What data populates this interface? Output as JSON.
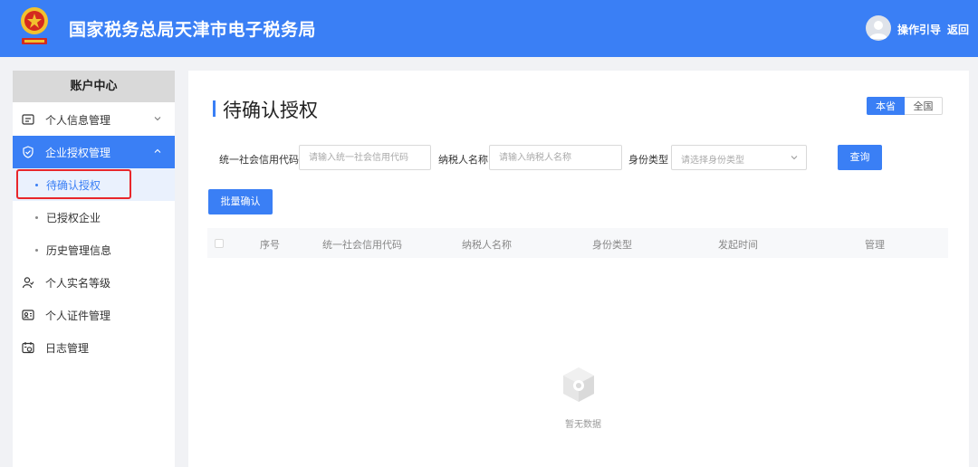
{
  "header": {
    "title": "国家税务总局天津市电子税务局",
    "guide_label": "操作引导",
    "back_label": "返回",
    "bg_color": "#3a7ff5"
  },
  "sidebar": {
    "heading": "账户中心",
    "menu": [
      {
        "label": "个人信息管理",
        "icon": "id-card-icon",
        "expanded": false
      },
      {
        "label": "企业授权管理",
        "icon": "shield-check-icon",
        "expanded": true,
        "active": true
      },
      {
        "label": "个人实名等级",
        "icon": "person-icon"
      },
      {
        "label": "个人证件管理",
        "icon": "badge-icon"
      },
      {
        "label": "日志管理",
        "icon": "calendar-icon"
      }
    ],
    "sub_items": [
      {
        "label": "待确认授权",
        "selected": true
      },
      {
        "label": "已授权企业"
      },
      {
        "label": "历史管理信息"
      }
    ]
  },
  "main": {
    "title": "待确认授权",
    "region_toggle": [
      "本省",
      "全国"
    ],
    "filters": {
      "credit_code_label": "统一社会信用代码",
      "credit_code_placeholder": "请输入统一社会信用代码",
      "taxpayer_name_label": "纳税人名称",
      "taxpayer_name_placeholder": "请输入纳税人名称",
      "identity_type_label": "身份类型",
      "identity_type_placeholder": "请选择身份类型"
    },
    "query_label": "查询",
    "batch_confirm_label": "批量确认",
    "table_columns": [
      "序号",
      "统一社会信用代码",
      "纳税人名称",
      "身份类型",
      "发起时间",
      "管理"
    ],
    "empty_text": "暂无数据"
  }
}
